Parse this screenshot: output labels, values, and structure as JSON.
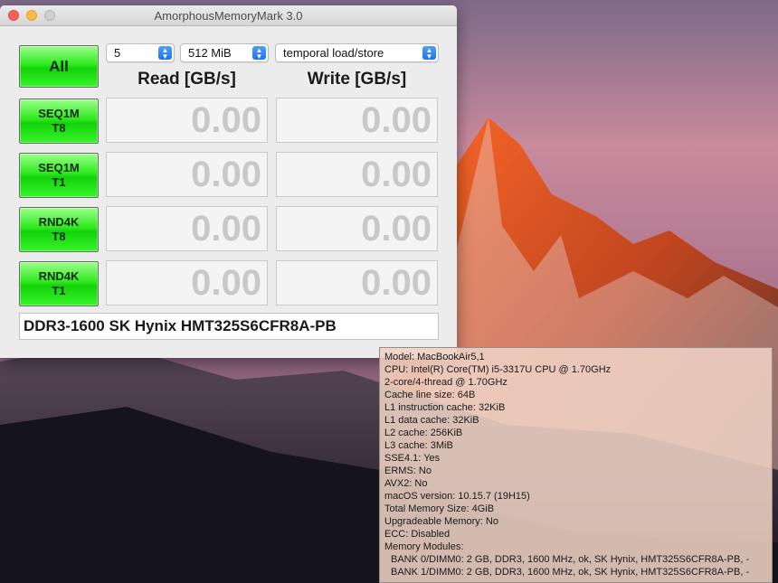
{
  "window": {
    "title": "AmorphousMemoryMark 3.0"
  },
  "controls": {
    "all_button": "All",
    "count_select": "5",
    "size_select": "512 MiB",
    "mode_select": "temporal load/store"
  },
  "headers": {
    "read": "Read [GB/s]",
    "write": "Write [GB/s]"
  },
  "tests": [
    {
      "line1": "SEQ1M",
      "line2": "T8",
      "read": "0.00",
      "write": "0.00"
    },
    {
      "line1": "SEQ1M",
      "line2": "T1",
      "read": "0.00",
      "write": "0.00"
    },
    {
      "line1": "RND4K",
      "line2": "T8",
      "read": "0.00",
      "write": "0.00"
    },
    {
      "line1": "RND4K",
      "line2": "T1",
      "read": "0.00",
      "write": "0.00"
    }
  ],
  "memory_label": "DDR3-1600 SK Hynix HMT325S6CFR8A-PB",
  "info": {
    "lines": [
      "Model: MacBookAir5,1",
      "CPU: Intel(R) Core(TM) i5-3317U CPU @ 1.70GHz",
      "2-core/4-thread @ 1.70GHz",
      "Cache line size: 64B",
      "L1 instruction cache: 32KiB",
      "L1 data cache: 32KiB",
      "L2 cache: 256KiB",
      "L3 cache: 3MiB",
      "SSE4.1: Yes",
      "ERMS: No",
      "AVX2: No",
      "macOS version: 10.15.7 (19H15)",
      "Total Memory Size: 4GiB",
      "Upgradeable Memory: No",
      "ECC: Disabled",
      "Memory Modules:"
    ],
    "modules": [
      "BANK 0/DIMM0: 2 GB, DDR3, 1600 MHz, ok, SK Hynix, HMT325S6CFR8A-PB, -",
      "BANK 1/DIMM0: 2 GB, DDR3, 1600 MHz, ok, SK Hynix, HMT325S6CFR8A-PB, -"
    ]
  },
  "colors": {
    "button_green": "#2eea1e",
    "result_text": "#c8c8c8",
    "close": "#fc605c",
    "minimize": "#fdbc40"
  }
}
